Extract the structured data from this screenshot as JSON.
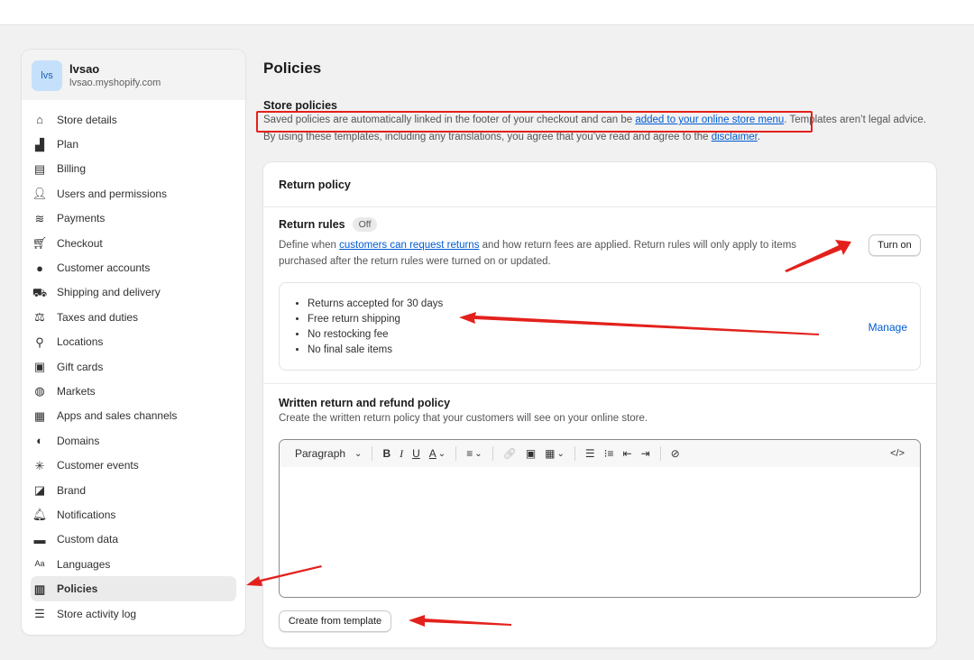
{
  "store": {
    "avatar_initials": "lvs",
    "name": "lvsao",
    "url": "lvsao.myshopify.com"
  },
  "sidebar": {
    "items": [
      {
        "label": "Store details",
        "icon": "store-icon"
      },
      {
        "label": "Plan",
        "icon": "plan-icon"
      },
      {
        "label": "Billing",
        "icon": "billing-icon"
      },
      {
        "label": "Users and permissions",
        "icon": "users-icon"
      },
      {
        "label": "Payments",
        "icon": "payments-icon"
      },
      {
        "label": "Checkout",
        "icon": "cart-icon"
      },
      {
        "label": "Customer accounts",
        "icon": "person-icon"
      },
      {
        "label": "Shipping and delivery",
        "icon": "truck-icon"
      },
      {
        "label": "Taxes and duties",
        "icon": "tax-icon"
      },
      {
        "label": "Locations",
        "icon": "location-icon"
      },
      {
        "label": "Gift cards",
        "icon": "gift-card-icon"
      },
      {
        "label": "Markets",
        "icon": "globe-icon"
      },
      {
        "label": "Apps and sales channels",
        "icon": "apps-icon"
      },
      {
        "label": "Domains",
        "icon": "domains-icon"
      },
      {
        "label": "Customer events",
        "icon": "events-icon"
      },
      {
        "label": "Brand",
        "icon": "brand-icon"
      },
      {
        "label": "Notifications",
        "icon": "bell-icon"
      },
      {
        "label": "Custom data",
        "icon": "custom-data-icon"
      },
      {
        "label": "Languages",
        "icon": "language-icon"
      },
      {
        "label": "Policies",
        "icon": "policies-icon",
        "active": true
      },
      {
        "label": "Store activity log",
        "icon": "list-icon"
      }
    ]
  },
  "main": {
    "title": "Policies",
    "store_policies": {
      "heading": "Store policies",
      "desc_before": "Saved policies are automatically linked in the footer of your checkout and can be ",
      "link1": "added to your online store menu",
      "desc_middle": ". Templates aren’t legal advice. By using these templates, including any translations, you agree that you’ve read and agree to the ",
      "link2": "disclaimer",
      "desc_end": "."
    },
    "return_policy": {
      "card_title": "Return policy",
      "rules_title": "Return rules",
      "rules_status": "Off",
      "rules_desc_before": "Define when ",
      "rules_link": "customers can request returns",
      "rules_desc_after": " and how return fees are applied. Return rules will only apply to items purchased after the return rules were turned on or updated.",
      "turn_on_label": "Turn on",
      "rules": [
        "Returns accepted for 30 days",
        "Free return shipping",
        "No restocking fee",
        "No final sale items"
      ],
      "manage_label": "Manage",
      "written_title": "Written return and refund policy",
      "written_desc": "Create the written return policy that your customers will see on your online store.",
      "editor": {
        "paragraph_label": "Paragraph",
        "bold": "B",
        "italic": "I",
        "underline": "U",
        "text_color": "A",
        "code_label": "</>"
      },
      "create_template_label": "Create from template"
    }
  },
  "colors": {
    "annotation_red": "#e3211c",
    "link_blue": "#005bd3"
  }
}
